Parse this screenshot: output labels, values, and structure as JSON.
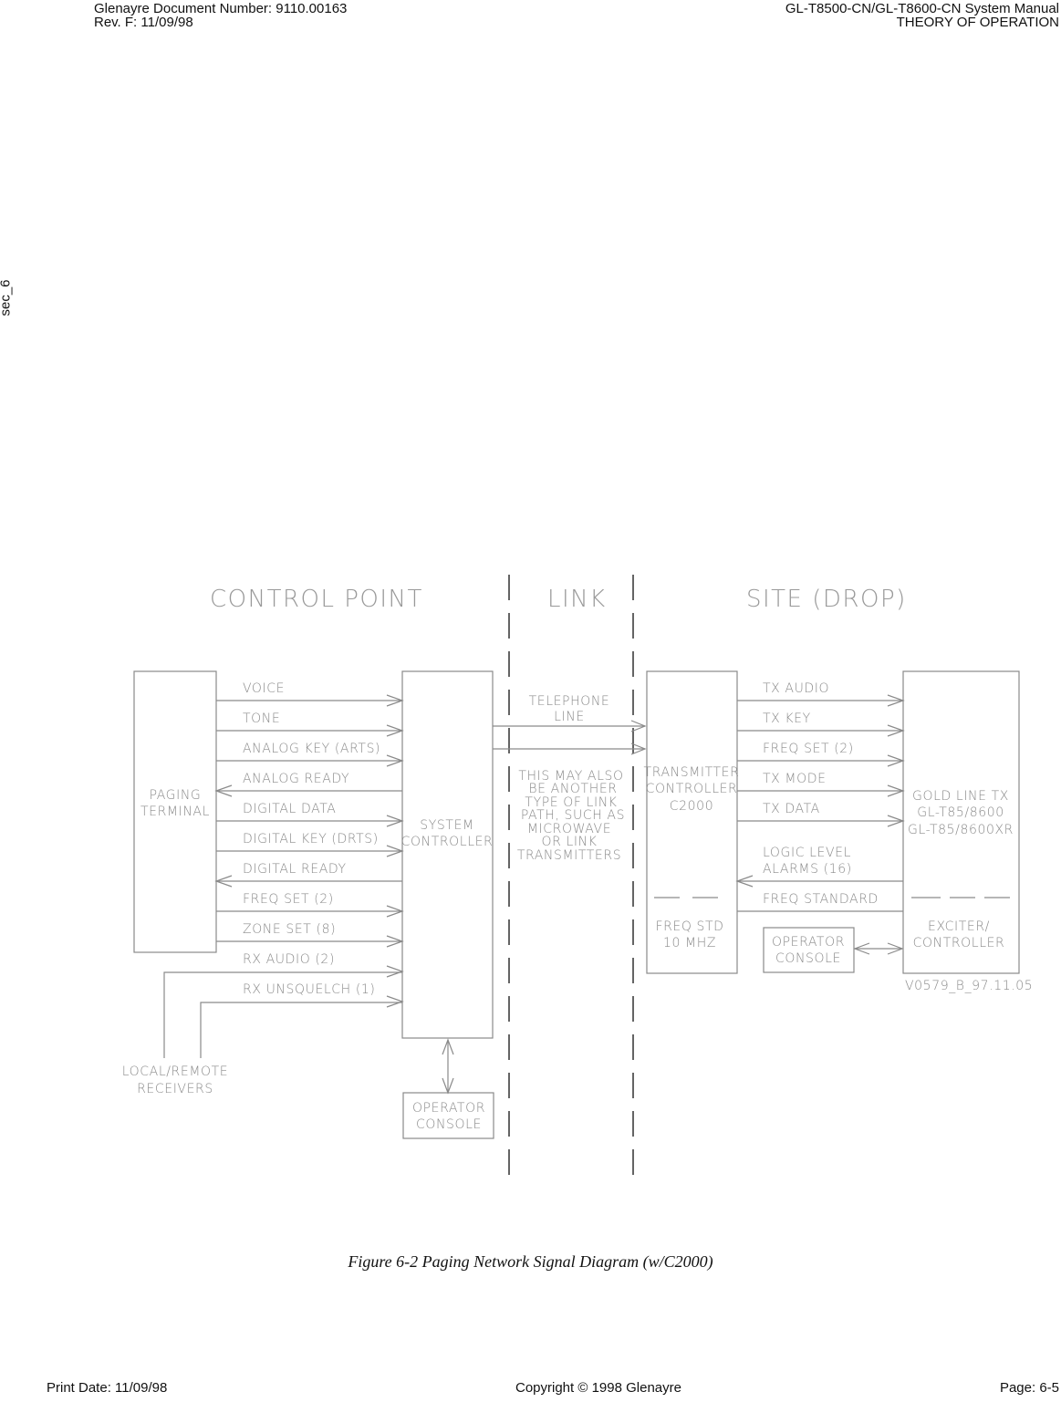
{
  "header": {
    "doc_number": "Glenayre Document Number: 9110.00163",
    "revision": "Rev. F: 11/09/98",
    "manual_title": "GL-T8500-CN/GL-T8600-CN System Manual",
    "section_title": "THEORY OF OPERATION"
  },
  "side_tab": "sec_6",
  "diagram": {
    "sections": {
      "control_point": "CONTROL POINT",
      "link": "LINK",
      "site": "SITE (DROP)"
    },
    "blocks": {
      "paging_terminal": [
        "PAGING",
        "TERMINAL"
      ],
      "system_controller": [
        "SYSTEM",
        "CONTROLLER"
      ],
      "operator_console_left": [
        "OPERATOR",
        "CONSOLE"
      ],
      "local_remote_receivers": [
        "LOCAL/REMOTE",
        "RECEIVERS"
      ],
      "transmitter_controller": [
        "TRANSMITTER",
        "CONTROLLER",
        "C2000"
      ],
      "freq_std": [
        "FREQ STD",
        "10 MHZ"
      ],
      "operator_console_right": [
        "OPERATOR",
        "CONSOLE"
      ],
      "gold_line_tx": [
        "GOLD LINE TX",
        "GL-T85/8600",
        "GL-T85/8600XR"
      ],
      "exciter_controller": [
        "EXCITER/",
        "CONTROLLER"
      ]
    },
    "link_labels": {
      "telephone_line": [
        "TELEPHONE",
        "LINE"
      ],
      "alt_link_note": [
        "THIS MAY ALSO",
        "BE ANOTHER",
        "TYPE OF LINK",
        "PATH, SUCH AS",
        "MICROWAVE",
        "OR LINK",
        "TRANSMITTERS"
      ]
    },
    "control_signals": [
      {
        "label": "VOICE",
        "direction": "to-controller"
      },
      {
        "label": "TONE",
        "direction": "to-controller"
      },
      {
        "label": "ANALOG KEY (ARTS)",
        "direction": "to-controller"
      },
      {
        "label": "ANALOG READY",
        "direction": "to-terminal"
      },
      {
        "label": "DIGITAL DATA",
        "direction": "to-controller"
      },
      {
        "label": "DIGITAL KEY (DRTS)",
        "direction": "to-controller"
      },
      {
        "label": "DIGITAL READY",
        "direction": "to-terminal"
      },
      {
        "label": "FREQ SET (2)",
        "direction": "to-controller"
      },
      {
        "label": "ZONE SET (8)",
        "direction": "to-controller"
      },
      {
        "label": "RX AUDIO (2)",
        "direction": "to-controller"
      },
      {
        "label": "RX UNSQUELCH (1)",
        "direction": "to-controller"
      }
    ],
    "site_signals": [
      {
        "label": "TX AUDIO",
        "direction": "to-transmitter"
      },
      {
        "label": "TX KEY",
        "direction": "to-transmitter"
      },
      {
        "label": "FREQ SET (2)",
        "direction": "to-transmitter"
      },
      {
        "label": "TX MODE",
        "direction": "to-transmitter"
      },
      {
        "label": "TX DATA",
        "direction": "to-transmitter"
      },
      {
        "label": "LOGIC LEVEL ALARMS (16)",
        "lines": [
          "LOGIC LEVEL",
          "ALARMS (16)"
        ],
        "direction": "to-c2000"
      },
      {
        "label": "FREQ STANDARD",
        "direction": "none"
      }
    ],
    "drawing_id": "V0579_B_97.11.05"
  },
  "caption": "Figure 6-2  Paging Network Signal Diagram (w/C2000)",
  "footer": {
    "print_date": "Print Date: 11/09/98",
    "copyright": "Copyright © 1998 Glenayre",
    "page": "Page: 6-5"
  }
}
